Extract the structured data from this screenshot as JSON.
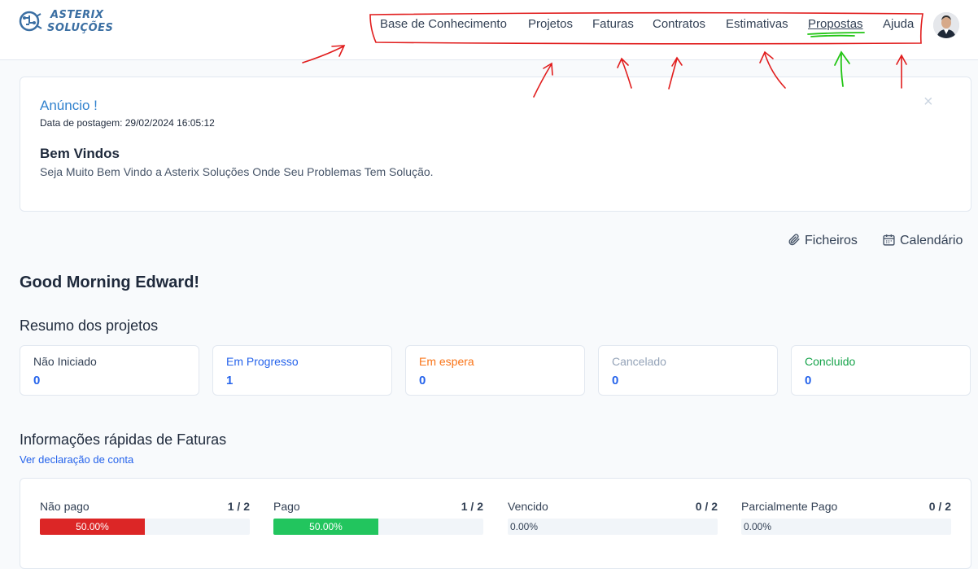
{
  "brand": {
    "line1": "ASTERIX",
    "line2": "SOLUÇÕES"
  },
  "nav": [
    {
      "label": "Base de Conhecimento"
    },
    {
      "label": "Projetos"
    },
    {
      "label": "Faturas"
    },
    {
      "label": "Contratos"
    },
    {
      "label": "Estimativas"
    },
    {
      "label": "Propostas"
    },
    {
      "label": "Ajuda"
    }
  ],
  "announcement": {
    "title": "Anúncio !",
    "date": "Data de postagem: 29/02/2024 16:05:12",
    "heading": "Bem Vindos",
    "body": "Seja Muito Bem Vindo a Asterix Soluções Onde Seu Problemas Tem Solução.",
    "close": "×"
  },
  "quick_links": {
    "files": "Ficheiros",
    "calendar": "Calendário"
  },
  "greeting": "Good Morning Edward!",
  "projects": {
    "title": "Resumo dos projetos",
    "cards": [
      {
        "label": "Não Iniciado",
        "value": "0",
        "color": "#334155"
      },
      {
        "label": "Em Progresso",
        "value": "1",
        "color": "#2563eb"
      },
      {
        "label": "Em espera",
        "value": "0",
        "color": "#f97316"
      },
      {
        "label": "Cancelado",
        "value": "0",
        "color": "#94a3b8"
      },
      {
        "label": "Concluido",
        "value": "0",
        "color": "#16a34a"
      }
    ]
  },
  "invoices": {
    "title": "Informações rápidas de Faturas",
    "account_link": "Ver declaração de conta",
    "items": [
      {
        "label": "Não pago",
        "count": "1 / 2",
        "percent_text": "50.00%",
        "fraction": 0.5,
        "color": "#dc2626"
      },
      {
        "label": "Pago",
        "count": "1 / 2",
        "percent_text": "50.00%",
        "fraction": 0.5,
        "color": "#22c55e"
      },
      {
        "label": "Vencido",
        "count": "0 / 2",
        "percent_text": "0.00%",
        "fraction": 0,
        "color": "#94a3b8"
      },
      {
        "label": "Parcialmente Pago",
        "count": "0 / 2",
        "percent_text": "0.00%",
        "fraction": 0,
        "color": "#94a3b8"
      }
    ]
  }
}
